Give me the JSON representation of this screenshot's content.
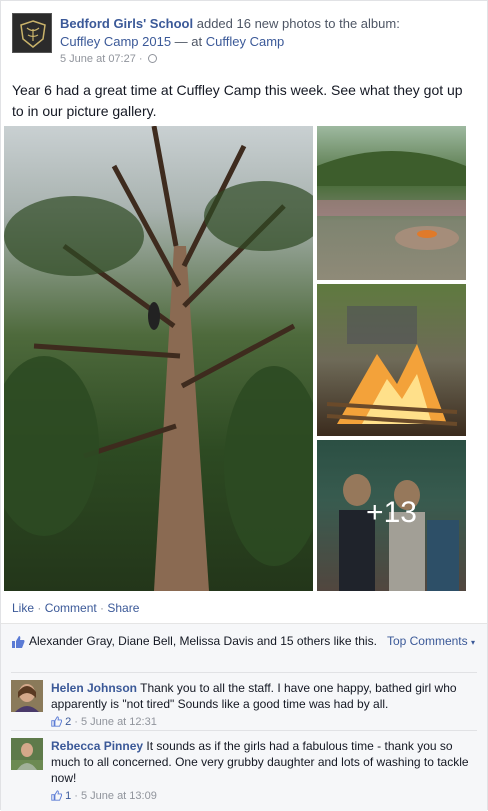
{
  "post": {
    "page_name": "Bedford Girls' School",
    "action_text": "added 16 new photos to the album:",
    "album_name": "Cuffley Camp 2015",
    "at_text": "— at",
    "location": "Cuffley Camp",
    "timestamp": "5 June at 07:27",
    "separator": "·",
    "status": "Year 6 had a great time at Cuffley Camp this week. See what they got up to in our picture gallery.",
    "more_photos": "+13"
  },
  "actions": {
    "like": "Like",
    "comment": "Comment",
    "share": "Share",
    "sep": " · "
  },
  "likes": {
    "text": "Alexander Gray, Diane Bell, Melissa Davis and 15 others like this.",
    "top_comments": "Top Comments"
  },
  "comments": [
    {
      "name": "Helen Johnson",
      "text": "Thank you to all the staff. I have one happy, bathed girl who apparently is \"not tired\" Sounds like a good time was had by all.",
      "like_count": "2",
      "time": "5 June at 12:31"
    },
    {
      "name": "Rebecca Pinney",
      "text": "It sounds as if the girls had a fabulous time - thank you so much to all concerned. One very grubby daughter and lots of washing to tackle now!",
      "like_count": "1",
      "time": "5 June at 13:09"
    }
  ],
  "icons": {
    "avatar": "school-crest-icon",
    "privacy": "globe-icon",
    "like": "thumbs-up-icon",
    "dropdown": "caret-down-icon"
  },
  "colors": {
    "link": "#3b5998",
    "meta": "#90949c",
    "likes_bg": "#f6f7f9"
  }
}
